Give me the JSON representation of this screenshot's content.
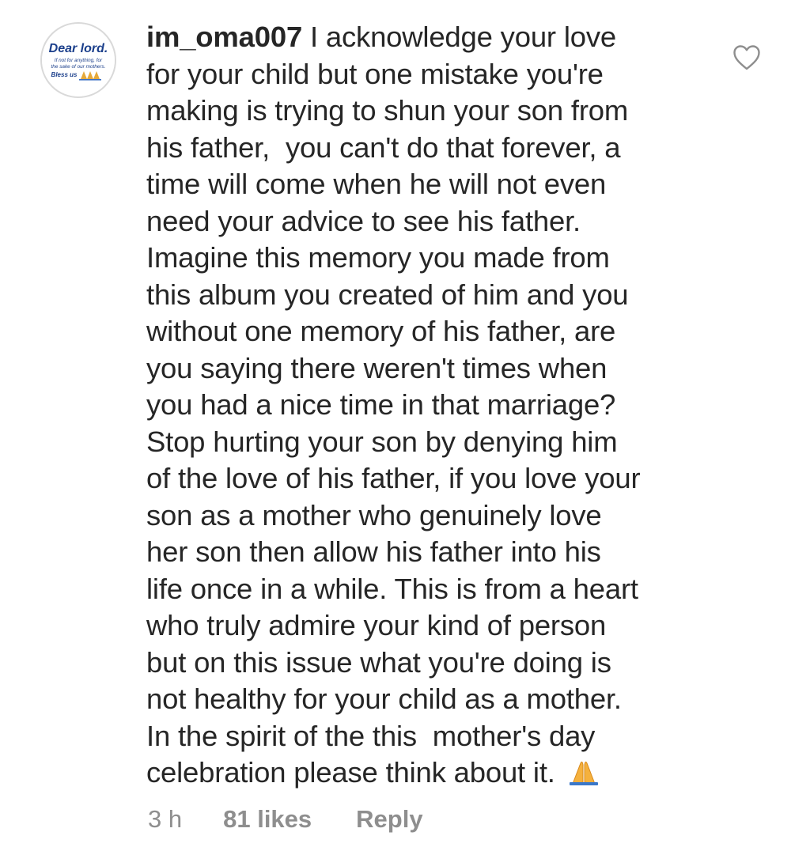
{
  "comment": {
    "avatar": {
      "icon": "profile-picture-avatar",
      "title": "Dear lord.",
      "subtitle_line1": "If not for anything, for",
      "subtitle_line2": "the sake of our mothers.",
      "footer": "Bless us"
    },
    "username": "im_oma007",
    "text_lines": [
      " I acknowledge your love",
      "for your child but one mistake you're",
      "making is trying to shun your son from",
      "his father,  you can't do that forever, a",
      "time will come when he will not even",
      "need your advice to see his father.",
      "Imagine this memory you made from",
      "this album you created of him and you",
      "without one memory of his father, are",
      "you saying there weren't times when",
      "you had a nice time in that marriage?",
      "Stop hurting your son by denying him",
      "of the love of his father, if you love your",
      "son as a mother who genuinely love",
      "her son then allow his father into his",
      "life once in a while. This is from a heart",
      "who truly admire your kind of person",
      "but on this issue what you're doing is",
      "not healthy for your child as a mother.",
      "In the spirit of the this  mother's day",
      "celebration please think about it. "
    ],
    "emoji": "folded-hands-emoji",
    "like_icon": "heart-outline-icon",
    "meta": {
      "time": "3 h",
      "likes": "81 likes",
      "reply": "Reply"
    }
  },
  "colors": {
    "text": "#262626",
    "muted": "#8e8e8e",
    "avatar_title": "#1b3f8b",
    "emoji": "#f6b93b"
  }
}
